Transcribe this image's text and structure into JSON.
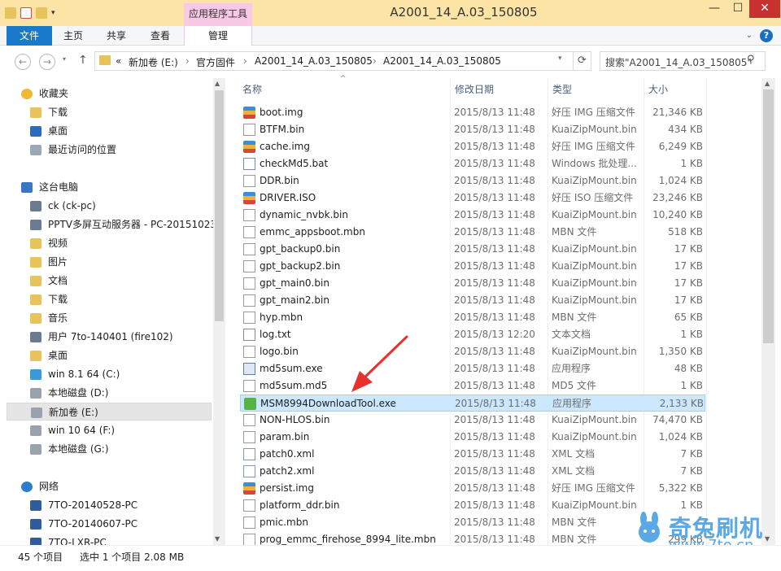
{
  "window": {
    "title": "A2001_14_A.03_150805",
    "contextual_tab": "应用程序工具",
    "min": "—",
    "max": "☐",
    "close": "✕"
  },
  "ribbon": {
    "tabs": [
      "文件",
      "主页",
      "共享",
      "查看",
      "管理"
    ],
    "help": "?",
    "expand": "⌄"
  },
  "nav": {
    "back": "←",
    "forward": "→",
    "history": "▾",
    "up": "↑",
    "breadcrumb": [
      "«",
      "新加卷 (E:)",
      "›",
      "官方固件",
      "›",
      "A2001_14_A.03_150805",
      "›",
      "A2001_14_A.03_150805"
    ],
    "dropdown": "▾",
    "refresh": "⟳",
    "search_placeholder": "搜索\"A2001_14_A.03_150805\"",
    "search_icon": "⚲"
  },
  "sidebar": {
    "items": [
      {
        "label": "收藏夹",
        "icon": "star-icon"
      },
      {
        "label": "下载",
        "icon": "download-folder-icon"
      },
      {
        "label": "桌面",
        "icon": "desktop-icon"
      },
      {
        "label": "最近访问的位置",
        "icon": "recent-places-icon"
      },
      {
        "label": "这台电脑",
        "icon": "computer-icon"
      },
      {
        "label": "ck (ck-pc)",
        "icon": "network-drive-icon"
      },
      {
        "label": "PPTV多屏互动服务器 - PC-20151023",
        "icon": "media-server-icon"
      },
      {
        "label": "视频",
        "icon": "videos-folder-icon"
      },
      {
        "label": "图片",
        "icon": "pictures-folder-icon"
      },
      {
        "label": "文档",
        "icon": "documents-folder-icon"
      },
      {
        "label": "下载",
        "icon": "download-folder-icon"
      },
      {
        "label": "音乐",
        "icon": "music-folder-icon"
      },
      {
        "label": "用户 7to-140401 (fire102)",
        "icon": "user-device-icon"
      },
      {
        "label": "桌面",
        "icon": "desktop-folder-icon"
      },
      {
        "label": "win 8.1 64 (C:)",
        "icon": "windows-drive-icon"
      },
      {
        "label": "本地磁盘 (D:)",
        "icon": "drive-icon"
      },
      {
        "label": "新加卷 (E:)",
        "icon": "drive-icon"
      },
      {
        "label": "win 10 64 (F:)",
        "icon": "drive-icon"
      },
      {
        "label": "本地磁盘 (G:)",
        "icon": "drive-icon"
      },
      {
        "label": "网络",
        "icon": "network-icon"
      },
      {
        "label": "7TO-20140528-PC",
        "icon": "network-computer-icon"
      },
      {
        "label": "7TO-20140607-PC",
        "icon": "network-computer-icon"
      },
      {
        "label": "7TO-LXR-PC",
        "icon": "network-computer-icon"
      }
    ]
  },
  "columns": {
    "name": "名称",
    "date": "修改日期",
    "type": "类型",
    "size": "大小",
    "sort_indicator": "^"
  },
  "files": [
    {
      "name": "boot.img",
      "date": "2015/8/13 11:48",
      "type": "好压 IMG 压缩文件",
      "size": "21,346 KB",
      "icon": "archive-icon"
    },
    {
      "name": "BTFM.bin",
      "date": "2015/8/13 11:48",
      "type": "KuaiZipMount.bin",
      "size": "434 KB",
      "icon": "file-icon"
    },
    {
      "name": "cache.img",
      "date": "2015/8/13 11:48",
      "type": "好压 IMG 压缩文件",
      "size": "6,249 KB",
      "icon": "archive-icon"
    },
    {
      "name": "checkMd5.bat",
      "date": "2015/8/13 11:48",
      "type": "Windows 批处理...",
      "size": "1 KB",
      "icon": "batch-icon"
    },
    {
      "name": "DDR.bin",
      "date": "2015/8/13 11:48",
      "type": "KuaiZipMount.bin",
      "size": "1,024 KB",
      "icon": "file-icon"
    },
    {
      "name": "DRIVER.ISO",
      "date": "2015/8/13 11:48",
      "type": "好压 ISO 压缩文件",
      "size": "23,246 KB",
      "icon": "archive-icon"
    },
    {
      "name": "dynamic_nvbk.bin",
      "date": "2015/8/13 11:48",
      "type": "KuaiZipMount.bin",
      "size": "10,240 KB",
      "icon": "file-icon"
    },
    {
      "name": "emmc_appsboot.mbn",
      "date": "2015/8/13 11:48",
      "type": "MBN 文件",
      "size": "518 KB",
      "icon": "file-icon"
    },
    {
      "name": "gpt_backup0.bin",
      "date": "2015/8/13 11:48",
      "type": "KuaiZipMount.bin",
      "size": "17 KB",
      "icon": "file-icon"
    },
    {
      "name": "gpt_backup2.bin",
      "date": "2015/8/13 11:48",
      "type": "KuaiZipMount.bin",
      "size": "17 KB",
      "icon": "file-icon"
    },
    {
      "name": "gpt_main0.bin",
      "date": "2015/8/13 11:48",
      "type": "KuaiZipMount.bin",
      "size": "17 KB",
      "icon": "file-icon"
    },
    {
      "name": "gpt_main2.bin",
      "date": "2015/8/13 11:48",
      "type": "KuaiZipMount.bin",
      "size": "17 KB",
      "icon": "file-icon"
    },
    {
      "name": "hyp.mbn",
      "date": "2015/8/13 11:48",
      "type": "MBN 文件",
      "size": "65 KB",
      "icon": "file-icon"
    },
    {
      "name": "log.txt",
      "date": "2015/8/13 12:20",
      "type": "文本文档",
      "size": "1 KB",
      "icon": "text-icon"
    },
    {
      "name": "logo.bin",
      "date": "2015/8/13 11:48",
      "type": "KuaiZipMount.bin",
      "size": "1,350 KB",
      "icon": "file-icon"
    },
    {
      "name": "md5sum.exe",
      "date": "2015/8/13 11:48",
      "type": "应用程序",
      "size": "48 KB",
      "icon": "exe-icon"
    },
    {
      "name": "md5sum.md5",
      "date": "2015/8/13 11:48",
      "type": "MD5 文件",
      "size": "1 KB",
      "icon": "file-icon"
    },
    {
      "name": "MSM8994DownloadTool.exe",
      "date": "2015/8/13 11:48",
      "type": "应用程序",
      "size": "2,133 KB",
      "icon": "download-tool-icon",
      "selected": true
    },
    {
      "name": "NON-HLOS.bin",
      "date": "2015/8/13 11:48",
      "type": "KuaiZipMount.bin",
      "size": "74,470 KB",
      "icon": "file-icon"
    },
    {
      "name": "param.bin",
      "date": "2015/8/13 11:48",
      "type": "KuaiZipMount.bin",
      "size": "1,024 KB",
      "icon": "file-icon"
    },
    {
      "name": "patch0.xml",
      "date": "2015/8/13 11:48",
      "type": "XML 文档",
      "size": "7 KB",
      "icon": "xml-icon"
    },
    {
      "name": "patch2.xml",
      "date": "2015/8/13 11:48",
      "type": "XML 文档",
      "size": "7 KB",
      "icon": "xml-icon"
    },
    {
      "name": "persist.img",
      "date": "2015/8/13 11:48",
      "type": "好压 IMG 压缩文件",
      "size": "5,322 KB",
      "icon": "archive-icon"
    },
    {
      "name": "platform_ddr.bin",
      "date": "2015/8/13 11:48",
      "type": "KuaiZipMount.bin",
      "size": "1 KB",
      "icon": "file-icon"
    },
    {
      "name": "pmic.mbn",
      "date": "2015/8/13 11:48",
      "type": "MBN 文件",
      "size": "",
      "icon": "file-icon"
    },
    {
      "name": "prog_emmc_firehose_8994_lite.mbn",
      "date": "2015/8/13 11:48",
      "type": "MBN 文件",
      "size": "299 KB",
      "icon": "file-icon"
    }
  ],
  "status": {
    "count": "45 个项目",
    "selected": "选中 1 个项目  2.08 MB"
  },
  "watermark": {
    "text": "奇兔刷机",
    "url": "www.7to.cn"
  },
  "colors": {
    "accent": "#1979ca",
    "selection": "#cce8ff",
    "annotation_arrow": "#e8312f",
    "watermark": "#5aa9e6"
  }
}
